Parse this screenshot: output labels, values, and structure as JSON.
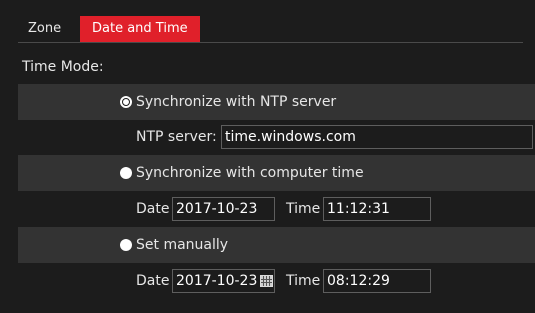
{
  "tabs": [
    {
      "label": "Zone",
      "active": false
    },
    {
      "label": "Date and Time",
      "active": true
    }
  ],
  "time_mode_label": "Time Mode:",
  "options": {
    "ntp": {
      "label": "Synchronize with NTP server",
      "selected": true
    },
    "computer": {
      "label": "Synchronize with computer time",
      "selected": false
    },
    "manual": {
      "label": "Set manually",
      "selected": false
    }
  },
  "ntp_server": {
    "label": "NTP server:",
    "value": "time.windows.com"
  },
  "computer_time": {
    "date_label": "Date",
    "date_value": "2017-10-23",
    "time_label": "Time",
    "time_value": "11:12:31"
  },
  "manual_time": {
    "date_label": "Date",
    "date_value": "2017-10-23",
    "time_label": "Time",
    "time_value": "08:12:29",
    "calendar_icon": "calendar-icon"
  },
  "colors": {
    "accent": "#e0202a",
    "background": "#1c1c1c",
    "row_shade": "#333333"
  }
}
